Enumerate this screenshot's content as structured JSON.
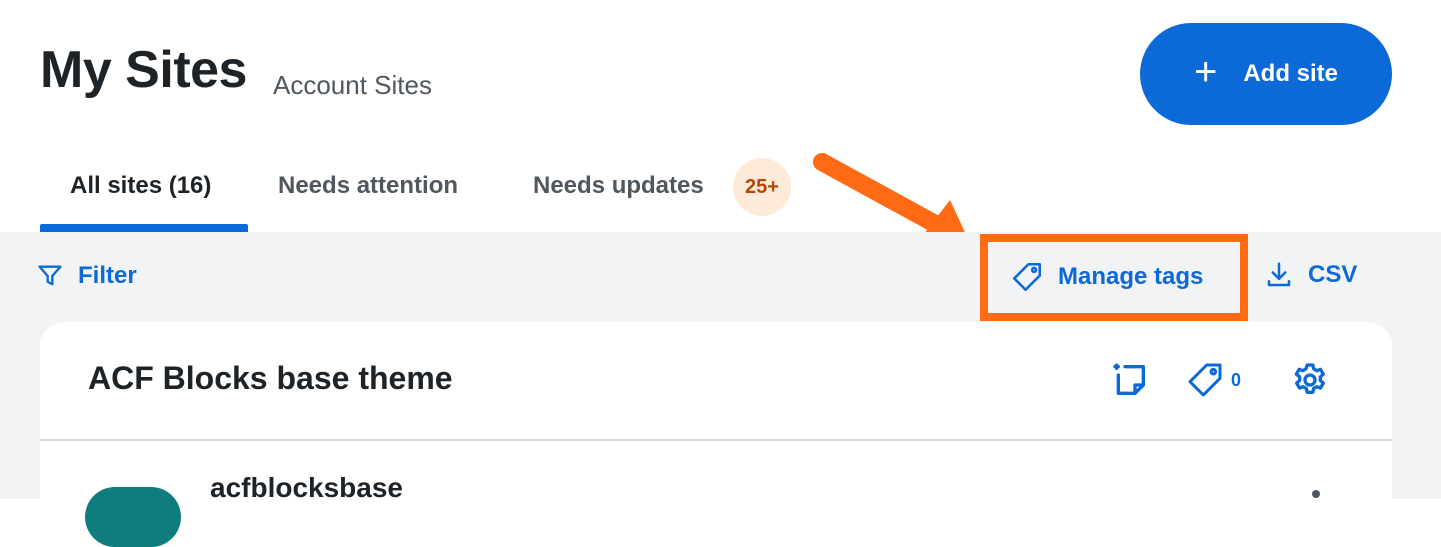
{
  "header": {
    "title": "My Sites",
    "subtitle": "Account Sites",
    "add_site_label": "Add site"
  },
  "tabs": [
    {
      "label": "All sites (16)",
      "active": true
    },
    {
      "label": "Needs attention",
      "active": false
    },
    {
      "label": "Needs updates",
      "active": false,
      "badge": "25+"
    }
  ],
  "toolbar": {
    "filter_label": "Filter",
    "manage_tags_label": "Manage tags",
    "csv_label": "CSV"
  },
  "site_group": {
    "name": "ACF Blocks base theme",
    "tag_count": "0",
    "sites": [
      {
        "name": "acfblocksbase"
      }
    ]
  },
  "icons": {
    "filter": "filter-icon",
    "tag": "tag-icon",
    "download": "download-icon",
    "add_note": "add-note-icon",
    "settings": "gear-icon",
    "plus": "plus-icon",
    "arrow": "annotation-arrow"
  },
  "colors": {
    "accent": "#0b6ad8",
    "highlight": "#ff6a13",
    "badge_bg": "#fdebd7",
    "badge_text": "#b54708",
    "avatar": "#0f7d7e"
  }
}
